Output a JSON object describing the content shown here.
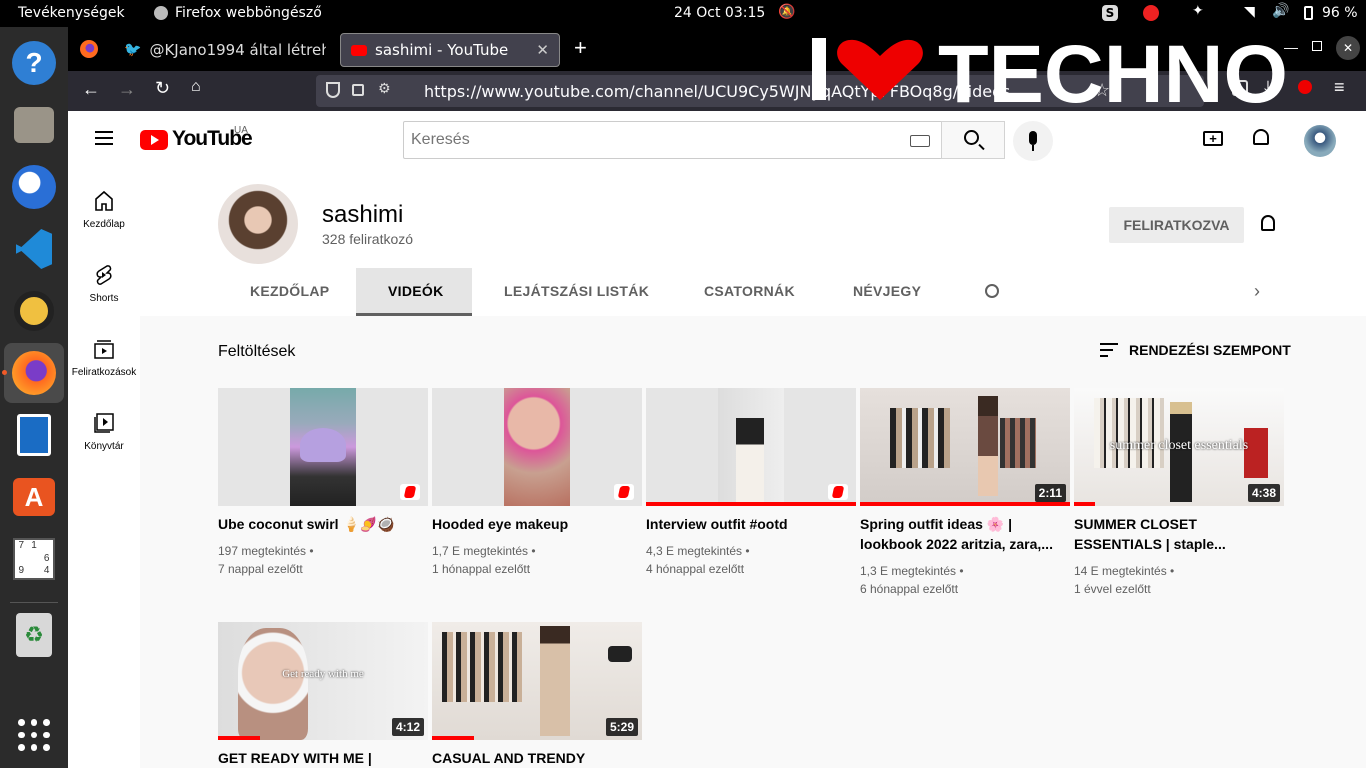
{
  "system": {
    "activities": "Tevékenységek",
    "app_name": "Firefox webböngésző",
    "clock": "24 Oct  03:15",
    "battery": "96 %"
  },
  "browser": {
    "tabs": [
      {
        "label": "@KJano1994 által létreh"
      },
      {
        "label": "sashimi - YouTube"
      }
    ],
    "url": "https://www.youtube.com/channel/UCU9Cy5WJNyqAQtYpFFBOq8g/videos",
    "watermark": "I ♥ TECHNO"
  },
  "youtube": {
    "region": "UA",
    "search_placeholder": "Keresés",
    "sidebar": [
      {
        "label": "Kezdőlap",
        "icon": "home-icon"
      },
      {
        "label": "Shorts",
        "icon": "shorts-icon"
      },
      {
        "label": "Feliratkozások",
        "icon": "subscriptions-icon"
      },
      {
        "label": "Könyvtár",
        "icon": "library-icon"
      }
    ],
    "channel": {
      "name": "sashimi",
      "subs": "328 feliratkozó",
      "subscribe_label": "FELIRATKOZVA"
    },
    "tabs": [
      "KEZDŐLAP",
      "VIDEÓK",
      "LEJÁTSZÁSI LISTÁK",
      "CSATORNÁK",
      "NÉVJEGY"
    ],
    "section_title": "Feltöltések",
    "sort_label": "RENDEZÉSI SZEMPONT",
    "videos": [
      {
        "title": "Ube coconut swirl 🍦🍠🥥",
        "views": "197 megtekintés",
        "age": "7 nappal ezelőtt",
        "shorts": true,
        "duration": "",
        "progress": 0,
        "thumb_text": ""
      },
      {
        "title": "Hooded eye makeup",
        "views": "1,7 E megtekintés",
        "age": "1 hónappal ezelőtt",
        "shorts": true,
        "duration": "",
        "progress": 0,
        "thumb_text": ""
      },
      {
        "title": "Interview outfit #ootd",
        "views": "4,3 E megtekintés",
        "age": "4 hónappal ezelőtt",
        "shorts": true,
        "duration": "",
        "progress": 1.0,
        "thumb_text": ""
      },
      {
        "title": "Spring outfit ideas 🌸 | lookbook 2022 aritzia, zara,...",
        "views": "1,3 E megtekintés",
        "age": "6 hónappal ezelőtt",
        "shorts": false,
        "duration": "2:11",
        "progress": 1.0,
        "thumb_text": ""
      },
      {
        "title": "SUMMER CLOSET ESSENTIALS | staple...",
        "views": "14 E megtekintés",
        "age": "1 évvel ezelőtt",
        "shorts": false,
        "duration": "4:38",
        "progress": 0.1,
        "thumb_text": "summer closet essentials"
      },
      {
        "title": "GET READY WITH ME |",
        "views": "",
        "age": "",
        "shorts": false,
        "duration": "4:12",
        "progress": 0.2,
        "thumb_text": "Get ready with me"
      },
      {
        "title": "CASUAL AND TRENDY",
        "views": "",
        "age": "",
        "shorts": false,
        "duration": "5:29",
        "progress": 0.2,
        "thumb_text": ""
      }
    ]
  }
}
